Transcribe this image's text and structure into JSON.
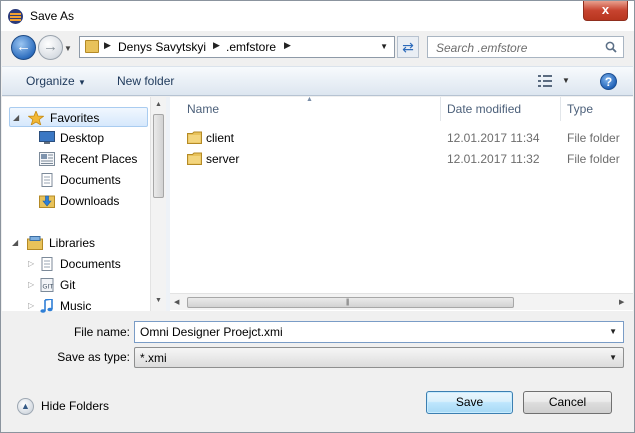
{
  "window": {
    "title": "Save As",
    "close_glyph": "x"
  },
  "address_bar": {
    "crumbs": [
      "Denys Savytskyi",
      ".emfstore"
    ],
    "search_placeholder": "Search .emfstore"
  },
  "toolbar": {
    "organize_label": "Organize",
    "new_folder_label": "New folder",
    "help_glyph": "?"
  },
  "navigation": {
    "groups": [
      {
        "label": "Favorites",
        "icon": "star-icon",
        "selected": true,
        "items": [
          {
            "label": "Desktop",
            "icon": "desktop-icon"
          },
          {
            "label": "Recent Places",
            "icon": "recent-places-icon"
          },
          {
            "label": "Documents",
            "icon": "documents-icon"
          },
          {
            "label": "Downloads",
            "icon": "downloads-icon"
          }
        ]
      },
      {
        "label": "Libraries",
        "icon": "libraries-icon",
        "selected": false,
        "items": [
          {
            "label": "Documents",
            "icon": "documents-icon"
          },
          {
            "label": "Git",
            "icon": "git-icon"
          },
          {
            "label": "Music",
            "icon": "music-icon"
          }
        ]
      }
    ]
  },
  "file_list": {
    "columns": [
      "Name",
      "Date modified",
      "Type"
    ],
    "rows": [
      {
        "name": "client",
        "date": "12.01.2017 11:34",
        "type": "File folder",
        "icon": "folder-icon"
      },
      {
        "name": "server",
        "date": "12.01.2017 11:32",
        "type": "File folder",
        "icon": "folder-icon"
      }
    ]
  },
  "form": {
    "file_name_label": "File name:",
    "file_name_value": "Omni Designer Proejct.xmi",
    "save_type_label": "Save as type:",
    "save_type_value": "*.xmi"
  },
  "footer": {
    "hide_folders_label": "Hide Folders",
    "save_label": "Save",
    "cancel_label": "Cancel"
  },
  "colors": {
    "accent": "#3c7fb1",
    "close_button": "#c7432f",
    "folder": "#e8c25a",
    "header_text": "#4c607a"
  }
}
